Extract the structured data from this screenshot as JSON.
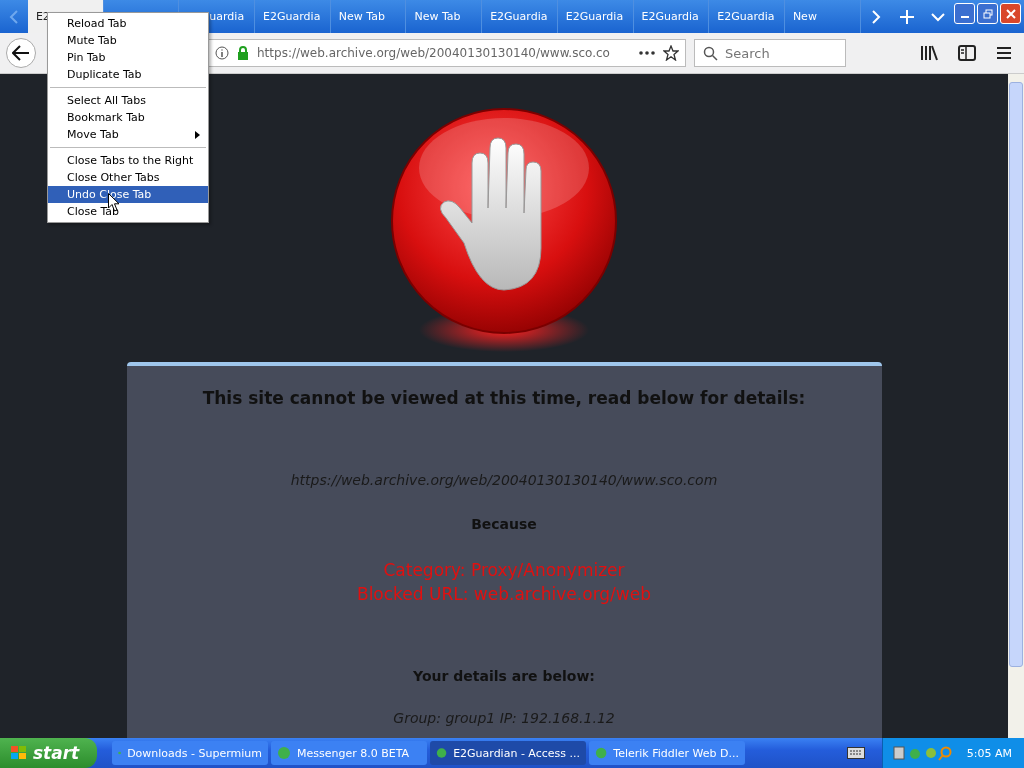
{
  "tabs": [
    {
      "label": "E2",
      "selected": true
    },
    {
      "selected": false
    },
    {
      "label": "uardia",
      "selected": false,
      "kind": "clipped"
    },
    {
      "label": "E2Guardia",
      "selected": false
    },
    {
      "label": "New Tab",
      "selected": false
    },
    {
      "label": "New Tab",
      "selected": false
    },
    {
      "label": "E2Guardia",
      "selected": false
    },
    {
      "label": "E2Guardia",
      "selected": false
    },
    {
      "label": "E2Guardia",
      "selected": false
    },
    {
      "label": "E2Guardia",
      "selected": false
    },
    {
      "label": "New",
      "selected": false
    }
  ],
  "toolbar": {
    "url": "https://web.archive.org/web/20040130130140/www.sco.co",
    "search": {
      "placeholder": "Search"
    }
  },
  "context_menu": [
    [
      {
        "label": "Reload Tab",
        "selected": false
      },
      {
        "label": "Mute Tab",
        "selected": false
      },
      {
        "label": "Pin Tab",
        "selected": false
      },
      {
        "label": "Duplicate Tab",
        "selected": false
      }
    ],
    [
      {
        "label": "Select All Tabs",
        "selected": false
      },
      {
        "label": "Bookmark Tab",
        "selected": false
      },
      {
        "label": "Move Tab",
        "selected": false,
        "submenu": true
      }
    ],
    [
      {
        "label": "Close Tabs to the Right",
        "selected": false
      },
      {
        "label": "Close Other Tabs",
        "selected": false
      },
      {
        "label": "Undo Close Tab",
        "selected": true
      },
      {
        "label": "Close Tab",
        "selected": false
      }
    ]
  ],
  "page": {
    "heading": "This site cannot be viewed at this time, read below for details:",
    "blocked_url": "https://web.archive.org/web/20040130130140/www.sco.com",
    "because": "Because",
    "reasons": [
      "Category: Proxy/Anonymizer",
      "Blocked URL: web.archive.org/web"
    ],
    "details_heading": "Your details are below:",
    "details": "Group: group1   IP: 192.168.1.12"
  },
  "taskbar": {
    "start": "start",
    "tasks": [
      {
        "label": "Downloads - Supermium",
        "selected": false
      },
      {
        "label": "Messenger 8.0 BETA",
        "selected": false
      },
      {
        "label": "E2Guardian - Access ...",
        "selected": true
      },
      {
        "label": "Telerik Fiddler Web D...",
        "selected": false
      }
    ],
    "clock": "5:05 AM"
  }
}
